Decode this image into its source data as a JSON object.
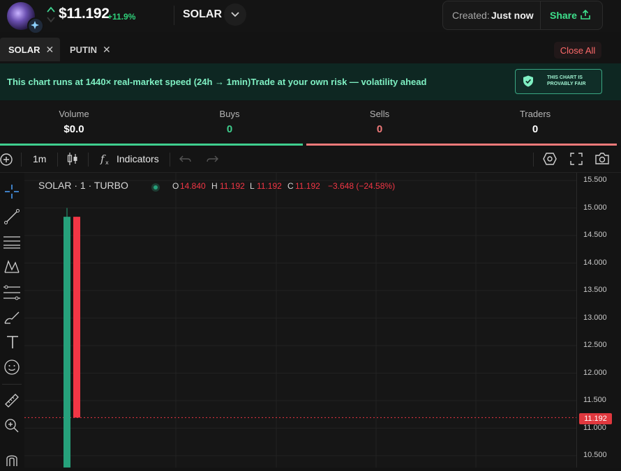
{
  "header": {
    "price": "$11.192",
    "change_pct": "+11.9%",
    "ticker": "SOLAR",
    "created_label": "Created:",
    "created_value": "Just now",
    "share_label": "Share"
  },
  "tabs": [
    {
      "label": "SOLAR",
      "active": true
    },
    {
      "label": "PUTIN",
      "active": false
    }
  ],
  "close_all_label": "Close All",
  "banner": {
    "text": "This chart runs at 1440× real-market speed (24h → 1min)Trade at your own risk — volatility ahead",
    "badge_line1": "THIS CHART IS",
    "badge_line2": "PROVABLY FAIR"
  },
  "stats": [
    {
      "label": "Volume",
      "value": "$0.0",
      "color": "#ffffff"
    },
    {
      "label": "Buys",
      "value": "0",
      "color": "#3fcf8e"
    },
    {
      "label": "Sells",
      "value": "0",
      "color": "#f07a7a"
    },
    {
      "label": "Traders",
      "value": "0",
      "color": "#ffffff"
    }
  ],
  "toolbar": {
    "interval": "1m",
    "indicators_label": "Indicators"
  },
  "chart": {
    "symbol_label": "SOLAR · 1 · TURBO",
    "ohlc": {
      "o_label": "O",
      "o": "14.840",
      "h_label": "H",
      "h": "11.192",
      "l_label": "L",
      "l": "11.192",
      "c_label": "C",
      "c": "11.192",
      "change": "−3.648 (−24.58%)"
    },
    "current_price_tag": "11.192"
  },
  "chart_data": {
    "type": "candlestick",
    "y_ticks": [
      "15.500",
      "15.000",
      "14.500",
      "14.000",
      "13.500",
      "13.000",
      "12.500",
      "12.000",
      "11.500",
      "11.000",
      "10.500"
    ],
    "ylim": [
      10.4,
      15.6
    ],
    "candles": [
      {
        "open": 10.0,
        "high": 15.0,
        "low": 10.0,
        "close": 14.84,
        "color": "#26a17b"
      },
      {
        "open": 14.84,
        "high": 14.84,
        "low": 11.192,
        "close": 11.192,
        "color": "#f23645"
      }
    ],
    "last_price": 11.192
  },
  "colors": {
    "accent_green": "#3fcf8e",
    "accent_red": "#f07a7a",
    "candle_up": "#26a17b",
    "candle_down": "#f23645"
  }
}
